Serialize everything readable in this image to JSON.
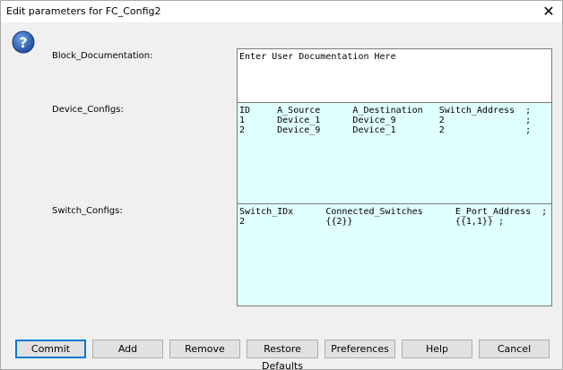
{
  "window": {
    "title": "Edit parameters for FC_Config2",
    "close_glyph": "✕"
  },
  "icons": {
    "help": "help-question-icon",
    "help_glyph": "?"
  },
  "colors": {
    "table_bg": "#e0ffff",
    "icon_blue": "#1f4e9c"
  },
  "params": {
    "block_doc_label": "Block_Documentation:",
    "block_doc_value": "Enter User Documentation Here",
    "device_label": "Device_Configs:",
    "device_value": "ID     A_Source      A_Destination   Switch_Address  ;\n1      Device_1      Device_9        2               ;\n2      Device_9      Device_1        2               ;",
    "switch_label": "Switch_Configs:",
    "switch_value": "Switch_IDx      Connected_Switches      E_Port_Address  ;\n2               {{2}}                   {{1,1}} ;"
  },
  "buttons": {
    "commit": "Commit",
    "add": "Add",
    "remove": "Remove",
    "restore": "Restore Defaults",
    "preferences": "Preferences",
    "help": "Help",
    "cancel": "Cancel"
  }
}
